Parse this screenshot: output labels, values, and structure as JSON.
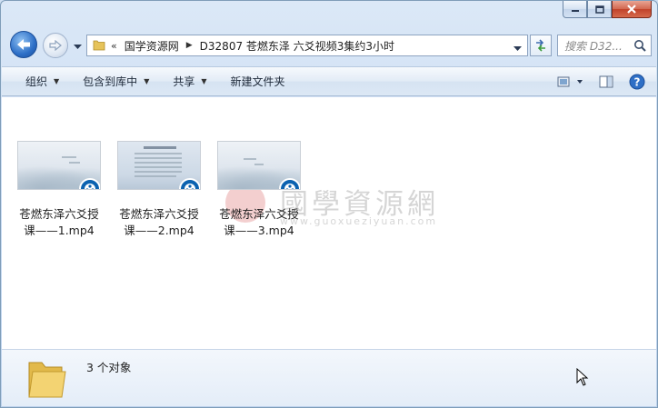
{
  "window": {
    "caption_buttons": [
      "minimize",
      "maximize",
      "close"
    ]
  },
  "address_bar": {
    "overflow_glyph": "«",
    "breadcrumbs": [
      "国学资源网",
      "D32807 苍燃东泽 六爻视频3集约3小时"
    ]
  },
  "search": {
    "placeholder": "搜索 D32..."
  },
  "toolbar": {
    "organize": "组织",
    "include_in_library": "包含到库中",
    "share": "共享",
    "new_folder": "新建文件夹"
  },
  "files": [
    {
      "name": "苍燃东泽六爻授课——1.mp4",
      "line1": "苍燃东泽六爻授",
      "line2": "课——1.mp4",
      "thumb": "mist"
    },
    {
      "name": "苍燃东泽六爻授课——2.mp4",
      "line1": "苍燃东泽六爻授",
      "line2": "课——2.mp4",
      "thumb": "text"
    },
    {
      "name": "苍燃东泽六爻授课——3.mp4",
      "line1": "苍燃东泽六爻授",
      "line2": "课——3.mp4",
      "thumb": "mist"
    }
  ],
  "watermark": {
    "title": "國學資源網",
    "url": "www.guoxueziyuan.com"
  },
  "details": {
    "count_text": "3 个对象"
  },
  "colors": {
    "accent": "#2d6fc7",
    "badge": "#0b62b0",
    "close": "#c1422a"
  }
}
